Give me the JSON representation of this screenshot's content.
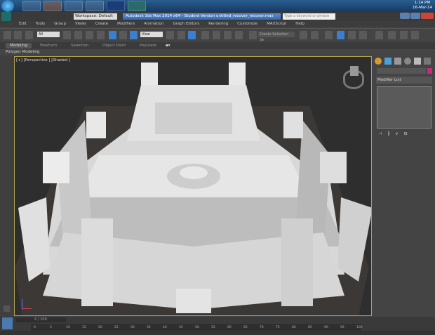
{
  "taskbar": {
    "apps": [
      "windows-explorer",
      "media-player",
      "chrome",
      "sticky-notes",
      "photoshop",
      "3ds-max"
    ],
    "time": "1:14 PM",
    "date": "16-Mar-14"
  },
  "titlebar": {
    "workspace": "Workspace: Default",
    "title": "Autodesk 3ds Max 2014 x64 - Student Version   untitled_recover_recover.max",
    "search_placeholder": "Type a keyword or phrase"
  },
  "menu": [
    "Edit",
    "Tools",
    "Group",
    "Views",
    "Create",
    "Modifiers",
    "Animation",
    "Graph Editors",
    "Rendering",
    "Customize",
    "MAXScript",
    "Help"
  ],
  "toolbar": {
    "filter": "All",
    "ref_coord": "View",
    "selection_set": "Create Selection Se"
  },
  "ribbon": {
    "tabs": [
      "Modeling",
      "Freeform",
      "Selection",
      "Object Paint",
      "Populate"
    ],
    "active": "Modeling",
    "sub": "Polygon Modeling"
  },
  "viewport": {
    "label": "[+] [Perspective ] [Shaded ]"
  },
  "command_panel": {
    "modifier_list": "Modifier List",
    "color": "#d0287f"
  },
  "timeline": {
    "frame": "0 / 100",
    "ticks": [
      "0",
      "5",
      "10",
      "15",
      "20",
      "25",
      "30",
      "35",
      "40",
      "45",
      "50",
      "55",
      "60",
      "65",
      "70",
      "75",
      "80",
      "85",
      "90",
      "95",
      "100"
    ]
  }
}
